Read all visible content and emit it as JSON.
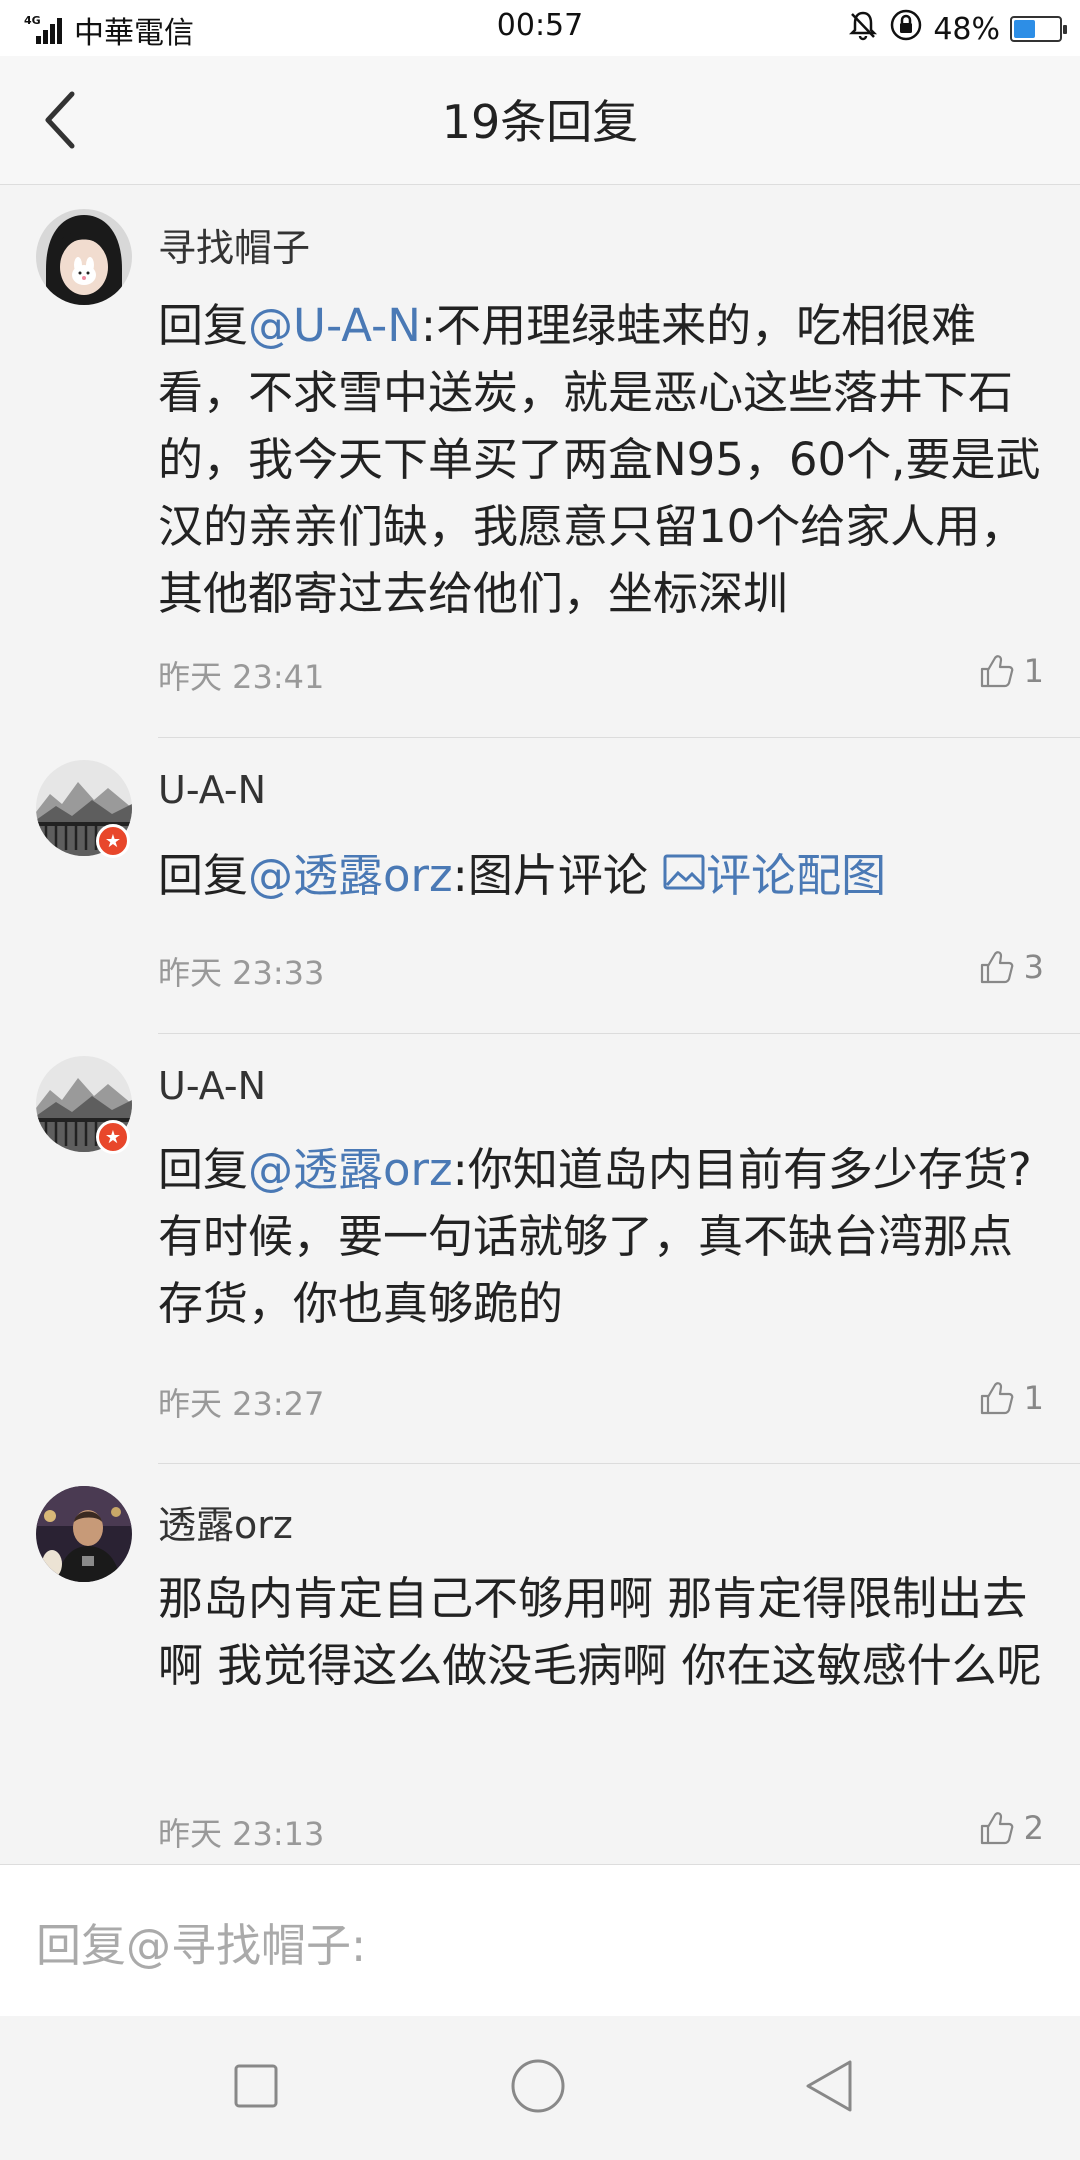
{
  "status_bar": {
    "network": "4G",
    "carrier": "中華電信",
    "time": "00:57",
    "battery": "48%",
    "battery_level": 0.48,
    "icons": [
      "signal-icon",
      "mute-bell-icon",
      "rotation-lock-icon",
      "battery-icon"
    ]
  },
  "header": {
    "title": "19条回复",
    "back_icon": "chevron-left-icon"
  },
  "comments": [
    {
      "author": "寻找帽子",
      "reply_prefix": "回复",
      "mention": "@U-A-N",
      "text": ":不用理绿蛙来的，吃相很难看，不求雪中送炭，就是恶心这些落井下石的，我今天下单买了两盒N95，60个,要是武汉的亲亲们缺，我愿意只留10个给家人用，其他都寄过去给他们，坐标深圳",
      "time": "昨天 23:41",
      "likes": "1"
    },
    {
      "author": "U-A-N",
      "reply_prefix": "回复",
      "mention": "@透露orz",
      "text": ":图片评论 ",
      "link_icon": "image-icon",
      "link_text": "评论配图",
      "time": "昨天 23:33",
      "likes": "3"
    },
    {
      "author": "U-A-N",
      "reply_prefix": "回复",
      "mention": "@透露orz",
      "text": ":你知道岛内目前有多少存货?有时候，要一句话就够了，真不缺台湾那点存货，你也真够跪的",
      "time": "昨天 23:27",
      "likes": "1"
    },
    {
      "author": "透露orz",
      "text": "那岛内肯定自己不够用啊 那肯定得限制出去啊 我觉得这么做没毛病啊 你在这敏感什么呢",
      "time": "昨天 23:13",
      "likes": "2"
    }
  ],
  "reply_input": {
    "placeholder": "回复@寻找帽子:"
  },
  "nav_bar": {
    "buttons": [
      "recent-apps-square-icon",
      "home-circle-icon",
      "back-triangle-icon"
    ]
  },
  "colors": {
    "mention": "#4a79b5",
    "badge": "#e8472b",
    "battery_fill": "#2d8ee6"
  }
}
